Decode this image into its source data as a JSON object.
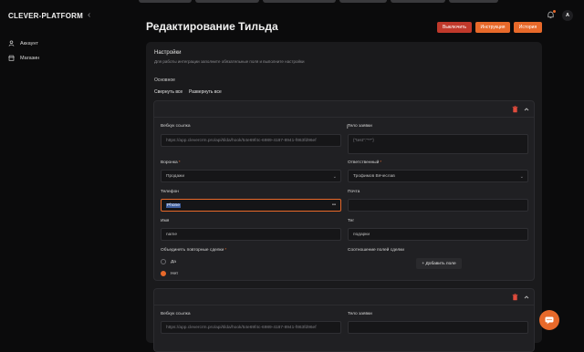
{
  "app": {
    "brand": "CLEVER-PLATFORM",
    "collapse_icon": "chevron-left-icon"
  },
  "sidebar": {
    "items": [
      {
        "label": "Аккаунт",
        "icon": "user-icon"
      },
      {
        "label": "Магазин",
        "icon": "store-icon"
      }
    ]
  },
  "header": {
    "title": "Редактирование Тильда",
    "buttons": [
      {
        "label": "Выключить",
        "color": "#c0392b"
      },
      {
        "label": "Инструкция",
        "color": "#e8692a"
      },
      {
        "label": "История",
        "color": "#e8692a"
      }
    ],
    "avatar_letter": "A"
  },
  "settings": {
    "title": "Настройки",
    "subtitle": "Для работы интеграции заполните обязательные поля и выполните настройки",
    "section": "Основное",
    "collapse_all": "Свернуть все",
    "expand_all": "Развернуть все"
  },
  "block1": {
    "webhook_label": "Вебхук ссылка",
    "webhook_value": "https://app.clevercrm.pro/api/tilda/hook/54e69f4c-6989-4187-8941-f863fd96ef",
    "body_label": "Тело заявки",
    "body_value": "{\"test\":\"**\"}",
    "funnel_label": "Воронка",
    "funnel_value": "Продажи",
    "responsible_label": "Ответственный",
    "responsible_value": "Трофимов Вячеслав",
    "phone_label": "Телефон",
    "phone_value": "Phone",
    "mail_label": "Почта",
    "mail_value": "",
    "name_label": "Имя",
    "name_value": "name",
    "tag_label": "Тег",
    "tag_value": "подарки",
    "merge_label": "Объединять повторные сделки",
    "merge_yes": "Да",
    "merge_no": "Нет",
    "merge_selected": "Нет",
    "fields_map_label": "Соотношение полей сделки",
    "add_field": "+ Добавить поле"
  },
  "block2": {
    "webhook_label": "Вебхук ссылка",
    "webhook_value": "https://app.clevercrm.pro/api/tilda/hook/54e69f4c-6989-4187-8941-f863fd96ef",
    "body_label": "Тело заявки"
  },
  "colors": {
    "accent": "#e8692a",
    "danger": "#c0392b",
    "background": "#0b0b0c",
    "card": "#1a1a1c"
  }
}
